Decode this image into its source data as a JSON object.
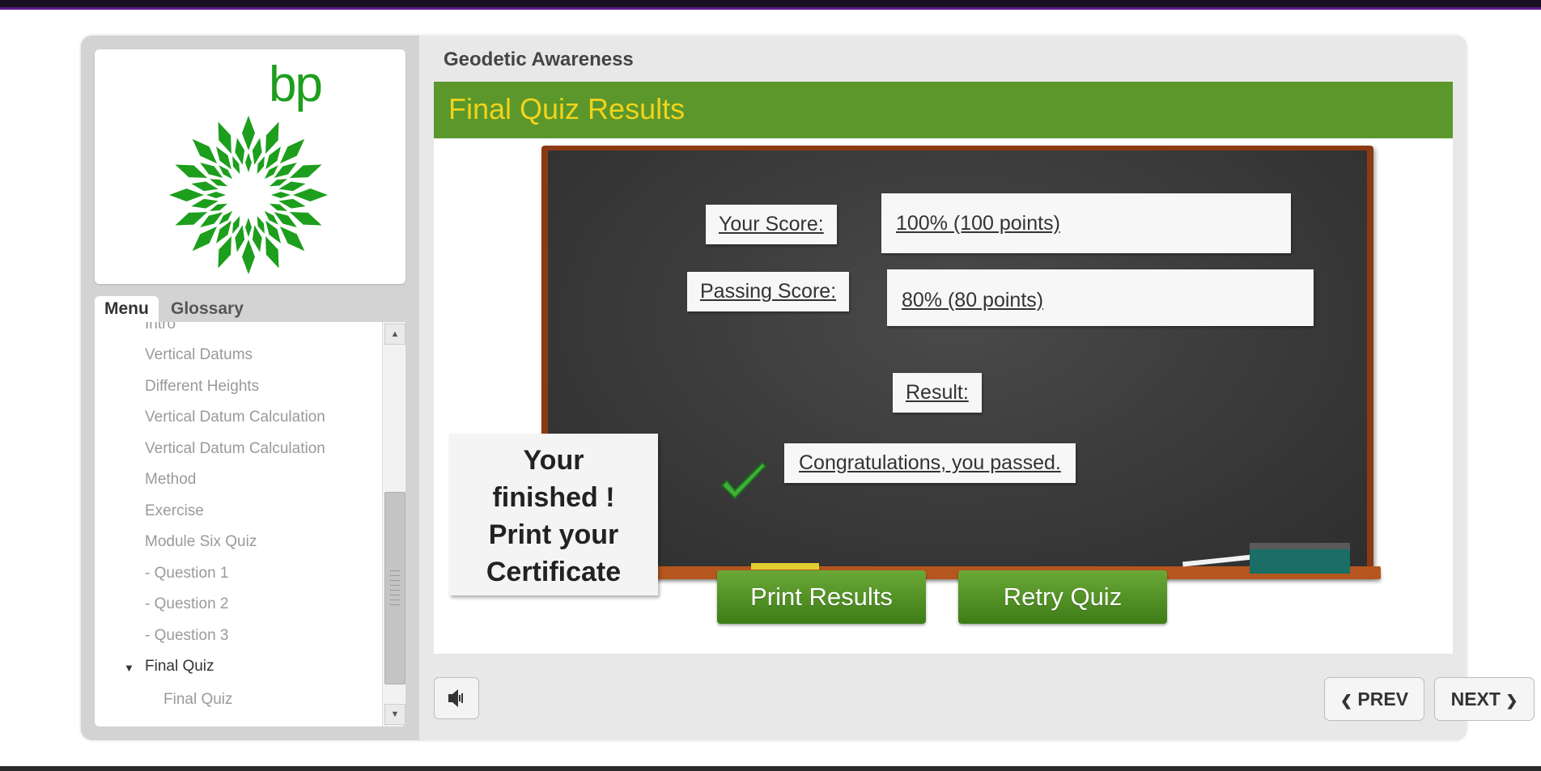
{
  "logo": {
    "text": "bp",
    "brand_color": "#1d9e1d"
  },
  "sidebar": {
    "tabs": [
      {
        "label": "Menu",
        "active": true
      },
      {
        "label": "Glossary",
        "active": false
      }
    ],
    "items": [
      {
        "label": "Intro"
      },
      {
        "label": "Vertical Datums"
      },
      {
        "label": "Different Heights"
      },
      {
        "label": "Vertical Datum Calculation"
      },
      {
        "label": "Vertical Datum Calculation"
      },
      {
        "label": "Method"
      },
      {
        "label": "Exercise"
      },
      {
        "label": "Module Six Quiz"
      },
      {
        "label": "- Question 1"
      },
      {
        "label": "- Question 2"
      },
      {
        "label": "- Question 3"
      },
      {
        "label": "Final Quiz",
        "expanded": true
      },
      {
        "label": "Final Quiz"
      }
    ]
  },
  "header": {
    "course_title": "Geodetic Awareness"
  },
  "slide": {
    "title": "Final Quiz Results",
    "header_color": "#5b972b",
    "title_color": "#f2d31b",
    "your_score_label": "Your Score:",
    "your_score_value": "100% (100 points)",
    "passing_score_label": "Passing Score:",
    "passing_score_value": "80% (80 points)",
    "result_label": "Result:",
    "result_message": "Congratulations, you passed.",
    "certificate_note": [
      "Your",
      "finished !",
      "Print your",
      "Certificate"
    ],
    "print_button": "Print Results",
    "retry_button": "Retry Quiz"
  },
  "footer": {
    "audio_icon": "speaker-icon",
    "prev_label": "PREV",
    "next_label": "NEXT"
  }
}
